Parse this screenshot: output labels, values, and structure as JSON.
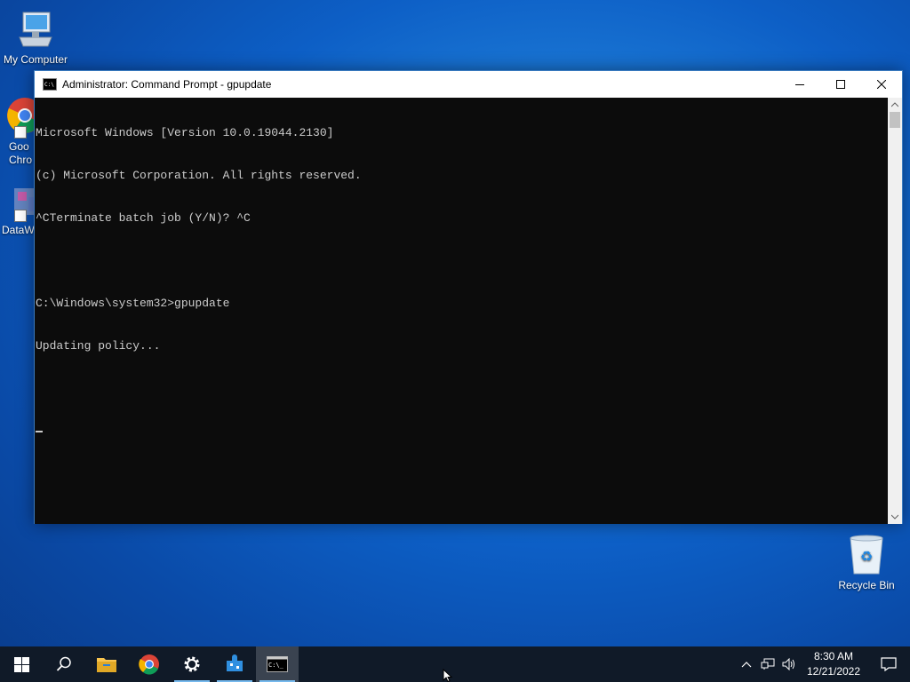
{
  "desktop": {
    "icons": [
      {
        "label": "My Computer",
        "icon": "computer-icon"
      },
      {
        "label": "Goo\nChro",
        "icon": "chrome-icon"
      },
      {
        "label": "DataW",
        "icon": "datawrapper-icon"
      },
      {
        "label": "Recycle Bin",
        "icon": "recycle-bin-icon"
      }
    ]
  },
  "window": {
    "title": "Administrator: Command Prompt - gpupdate",
    "controls": {
      "minimize": "minimize-icon",
      "maximize": "maximize-icon",
      "close": "close-icon"
    },
    "console_lines": [
      "Microsoft Windows [Version 10.0.19044.2130]",
      "(c) Microsoft Corporation. All rights reserved.",
      "^CTerminate batch job (Y/N)? ^C",
      "",
      "C:\\Windows\\system32>gpupdate",
      "Updating policy..."
    ]
  },
  "taskbar": {
    "buttons": [
      {
        "name": "start",
        "icon": "windows-logo-icon"
      },
      {
        "name": "search",
        "icon": "search-icon"
      },
      {
        "name": "file-explorer",
        "icon": "folder-icon"
      },
      {
        "name": "chrome",
        "icon": "chrome-icon"
      },
      {
        "name": "settings",
        "icon": "gear-icon"
      },
      {
        "name": "app",
        "icon": "puzzle-icon"
      },
      {
        "name": "command-prompt",
        "icon": "terminal-icon",
        "active": true
      }
    ],
    "tray": {
      "time": "8:30 AM",
      "date": "12/21/2022"
    }
  },
  "colors": {
    "taskbar": "#101a28",
    "console_bg": "#0c0c0c",
    "console_fg": "#cccccc",
    "accent": "#76b9ed"
  }
}
